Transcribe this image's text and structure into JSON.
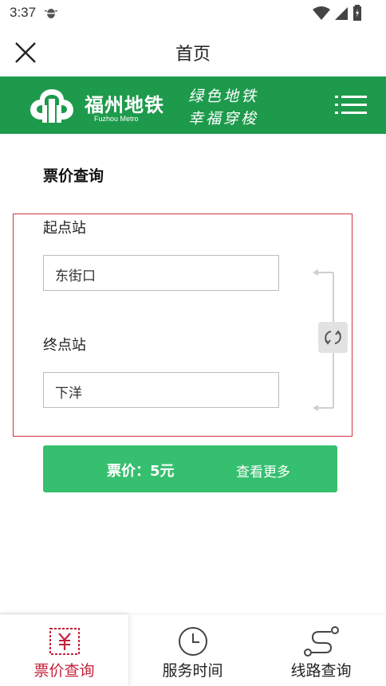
{
  "status_bar": {
    "time": "3:37"
  },
  "app_bar": {
    "title": "首页"
  },
  "banner": {
    "brand_cn": "福州地铁",
    "brand_en": "Fuzhou Metro",
    "slogan_line1": "绿色地铁",
    "slogan_line2": "幸福穿梭",
    "brand_color": "#1e9a4c"
  },
  "fare_query": {
    "title": "票价查询",
    "start_label": "起点站",
    "start_value": "东街口",
    "end_label": "终点站",
    "end_value": "下洋",
    "price_text": "票价：5元",
    "more_link": "查看更多",
    "accent_color": "#36bf6f",
    "highlight_color": "#d2323c"
  },
  "bottom_nav": {
    "items": [
      {
        "label": "票价查询",
        "icon": "yuan-ticket-icon",
        "active": true
      },
      {
        "label": "服务时间",
        "icon": "clock-icon",
        "active": false
      },
      {
        "label": "线路查询",
        "icon": "route-icon",
        "active": false
      }
    ],
    "active_color": "#c5213a"
  }
}
